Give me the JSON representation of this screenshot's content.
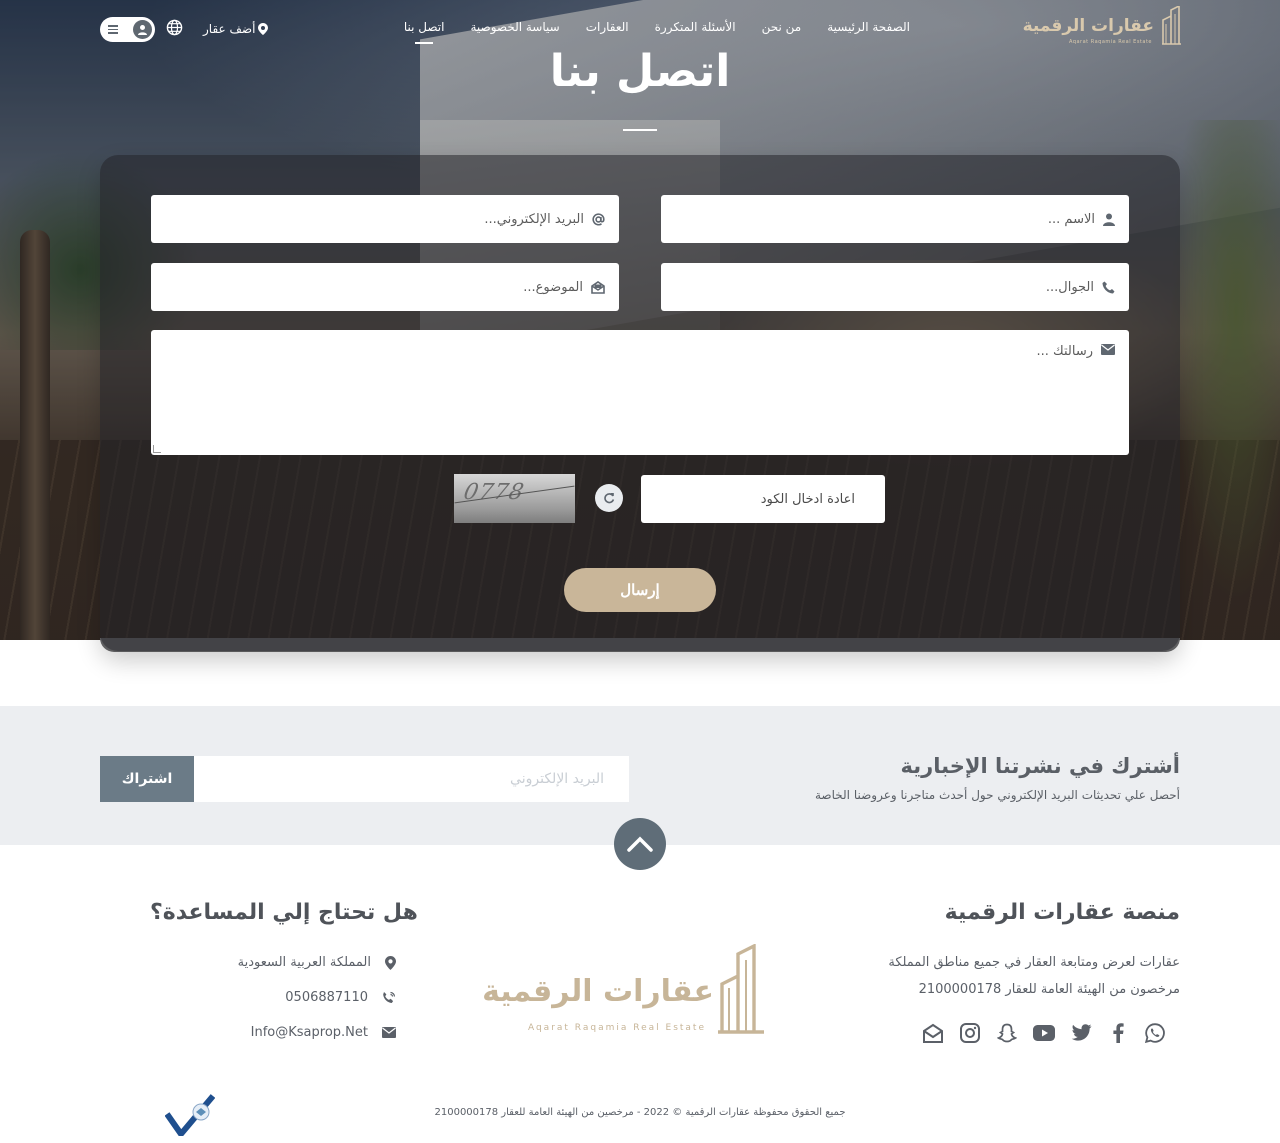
{
  "brand": {
    "name": "عقارات الرقمية",
    "tagline": "Aqarat Raqamia Real Estate",
    "accent_color": "#c9b699"
  },
  "nav": {
    "links": [
      "الصفحة الرئيسية",
      "من نحن",
      "الأسئلة المتكررة",
      "العقارات",
      "سياسة الخصوصية",
      "اتصل بنا"
    ],
    "active_link": "اتصل بنا",
    "add_property": "أضف عقار",
    "language_icon": "globe-icon",
    "user_menu_icons": [
      "menu-icon",
      "user-icon"
    ]
  },
  "page": {
    "title": "اتصل بنا"
  },
  "form": {
    "name_placeholder": "الاسم ...",
    "email_placeholder": "البريد الإلكتروني...",
    "phone_placeholder": "الجوال...",
    "subject_placeholder": "الموضوع...",
    "message_placeholder": "رسالتك ...",
    "captcha_placeholder": "اعادة ادخال الكود",
    "captcha_code": "0778",
    "submit_label": "إرسال"
  },
  "newsletter": {
    "title": "أشترك في نشرتنا الإخبارية",
    "subtitle": "أحصل علي تحديثات البريد الإلكتروني حول أحدث متاجرنا وعروضنا الخاصة",
    "email_placeholder": "البريد الإلكتروني",
    "button_label": "اشتراك"
  },
  "footer": {
    "about_title": "منصة عقارات الرقمية",
    "about_line1": "عقارات لعرض ومتابعة العقار في جميع مناطق المملكة",
    "about_line2": "مرخصون من الهيئة العامة للعقار 2100000178",
    "socials": [
      "whatsapp-icon",
      "facebook-icon",
      "twitter-icon",
      "youtube-icon",
      "snapchat-icon",
      "instagram-icon",
      "email-open-icon"
    ],
    "help_title": "هل تحتاج إلي المساعدة؟",
    "location": "المملكة العربية السعودية",
    "phone": "0506887110",
    "email": "Info@Ksaprop.Net",
    "copyright": "جميع الحقوق محفوظة عقارات الرقمية © 2022 - مرخصين من الهيئة العامة للعقار 2100000178"
  },
  "colors": {
    "newsletter_bg": "#eceef1",
    "subscribe_button": "#6b7b87",
    "scroll_top": "#5f6d78"
  }
}
